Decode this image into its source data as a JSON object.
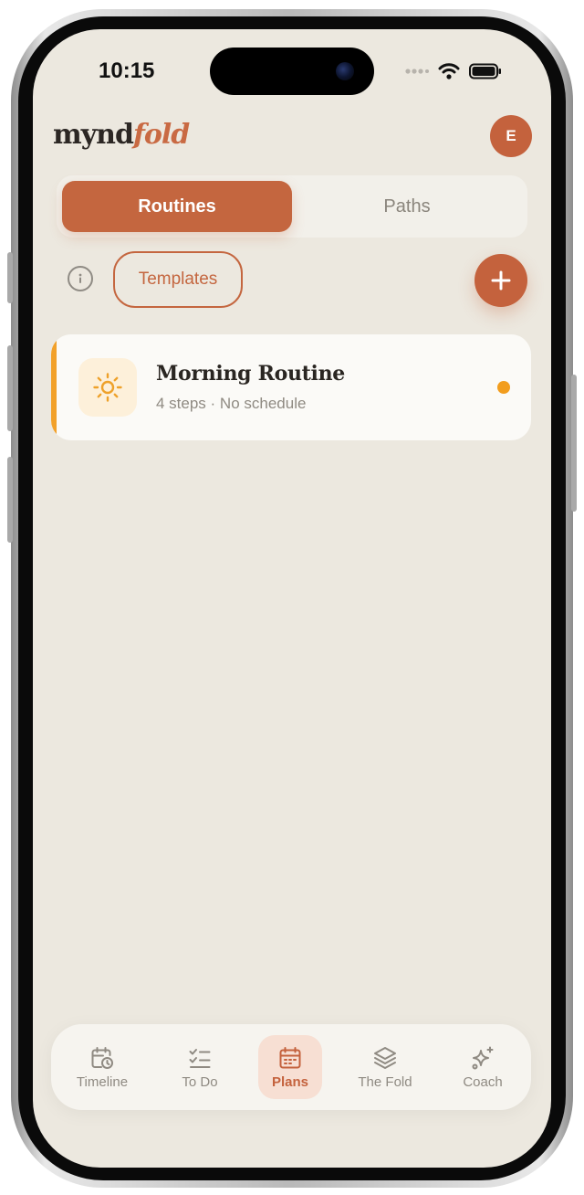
{
  "status_bar": {
    "time": "10:15"
  },
  "header": {
    "brand_prefix": "mynd",
    "brand_accent": "fold",
    "avatar_initial": "E"
  },
  "tabs": [
    {
      "label": "Routines",
      "active": true
    },
    {
      "label": "Paths",
      "active": false
    }
  ],
  "toolbar": {
    "info_icon": "info-icon",
    "templates_label": "Templates",
    "add_icon": "plus-icon"
  },
  "routines": [
    {
      "title": "Morning Routine",
      "subtitle": "4 steps · No schedule",
      "icon": "sun-icon",
      "accent_color": "#f2a12a",
      "status_color": "#f29d1e"
    }
  ],
  "bottom_nav": [
    {
      "label": "Timeline",
      "icon": "calendar-clock-icon",
      "active": false
    },
    {
      "label": "To Do",
      "icon": "checklist-icon",
      "active": false
    },
    {
      "label": "Plans",
      "icon": "calendar-icon",
      "active": true
    },
    {
      "label": "The Fold",
      "icon": "layers-icon",
      "active": false
    },
    {
      "label": "Coach",
      "icon": "sparkles-icon",
      "active": false
    }
  ],
  "colors": {
    "primary": "#c4623d",
    "background": "#ece8df",
    "card": "#fbfaf7",
    "muted_text": "#8f8a82"
  }
}
